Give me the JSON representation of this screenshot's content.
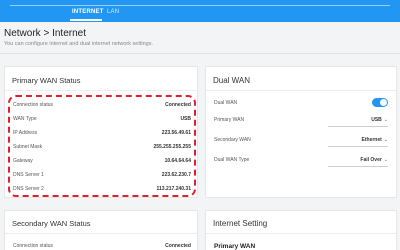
{
  "tabs": [
    {
      "label": "INTERNET"
    },
    {
      "label": "LAN"
    }
  ],
  "page": {
    "title": "Network > Internet",
    "description": "You can configure internet and dual internet network settings."
  },
  "primary_wan": {
    "title": "Primary WAN Status",
    "rows": [
      {
        "label": "Connection status",
        "value": "Connected"
      },
      {
        "label": "WAN Type",
        "value": "USB"
      },
      {
        "label": "IP Address",
        "value": "223.56.49.61"
      },
      {
        "label": "Subnet Mask",
        "value": "255.255.255.255"
      },
      {
        "label": "Gateway",
        "value": "10.64.64.64"
      },
      {
        "label": "DNS Server 1",
        "value": "223.62.230.7"
      },
      {
        "label": "DNS Server 2",
        "value": "113.217.240.31"
      }
    ]
  },
  "dual_wan": {
    "title": "Dual WAN",
    "rows": [
      {
        "label": "Dual WAN"
      },
      {
        "label": "Primary WAN",
        "value": "USB"
      },
      {
        "label": "Secondary WAN",
        "value": "Ethernet"
      },
      {
        "label": "Dual WAN Type",
        "value": "Fail Over"
      }
    ],
    "toggle_on": true
  },
  "secondary_wan": {
    "title": "Secondary WAN Status",
    "rows": [
      {
        "label": "Connection status",
        "value": "Connected"
      }
    ]
  },
  "internet_setting": {
    "title": "Internet Setting",
    "subtitle": "Primary WAN"
  },
  "colors": {
    "accent": "#2196f3",
    "highlight": "#e0202e"
  },
  "icons": {
    "dropdown": "chevron-down-icon"
  }
}
